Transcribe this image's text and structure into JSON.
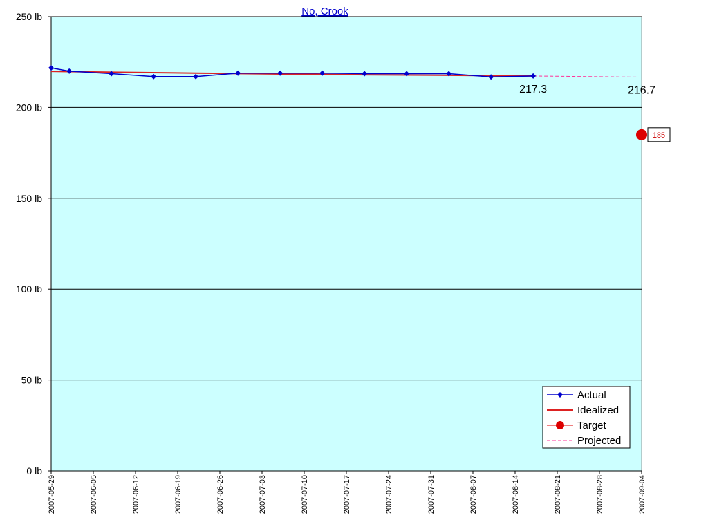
{
  "chart_data": {
    "type": "line",
    "title": "No, Crook",
    "xlabel": "",
    "ylabel": "",
    "ylim": [
      0,
      250
    ],
    "xlim": [
      "2007-05-29",
      "2007-09-04"
    ],
    "y_ticks": [
      "0 lb",
      "50 lb",
      "100 lb",
      "150 lb",
      "200 lb",
      "250 lb"
    ],
    "y_tick_values": [
      0,
      50,
      100,
      150,
      200,
      250
    ],
    "x_ticks": [
      "2007-05-29",
      "2007-06-05",
      "2007-06-12",
      "2007-06-19",
      "2007-06-26",
      "2007-07-03",
      "2007-07-10",
      "2007-07-17",
      "2007-07-24",
      "2007-07-31",
      "2007-08-07",
      "2007-08-14",
      "2007-08-21",
      "2007-08-28",
      "2007-09-04"
    ],
    "grid": "horizontal",
    "legend_position": "bottom-right",
    "colors": {
      "plot_bg": "#ccffff",
      "actual": "#0000cc",
      "idealized": "#dd2222",
      "target": "#dd0000",
      "projected": "#ff3399"
    },
    "series": [
      {
        "name": "Actual",
        "x": [
          "2007-05-29",
          "2007-06-01",
          "2007-06-08",
          "2007-06-15",
          "2007-06-22",
          "2007-06-29",
          "2007-07-06",
          "2007-07-13",
          "2007-07-20",
          "2007-07-27",
          "2007-08-03",
          "2007-08-10",
          "2007-08-17"
        ],
        "y": [
          221.8,
          220.0,
          218.6,
          217.0,
          217.0,
          218.9,
          218.9,
          218.9,
          218.6,
          218.6,
          218.6,
          216.8,
          217.3
        ]
      },
      {
        "name": "Idealized",
        "x": [
          "2007-05-29",
          "2007-06-08",
          "2007-06-22",
          "2007-07-06",
          "2007-07-20",
          "2007-08-03",
          "2007-08-17"
        ],
        "y": [
          219.9,
          219.4,
          218.9,
          218.4,
          218.0,
          217.7,
          217.3
        ]
      },
      {
        "name": "Target",
        "x": [
          "2007-09-04"
        ],
        "y": [
          185
        ]
      },
      {
        "name": "Projected",
        "x": [
          "2007-08-17",
          "2007-09-04"
        ],
        "y": [
          217.3,
          216.7
        ]
      }
    ],
    "annotations": [
      {
        "text": "217.3",
        "x": "2007-08-17",
        "y": 217.3
      },
      {
        "text": "216.7",
        "x": "2007-09-04",
        "y": 216.7
      },
      {
        "text": "185",
        "x": "2007-09-04",
        "y": 185
      }
    ]
  }
}
